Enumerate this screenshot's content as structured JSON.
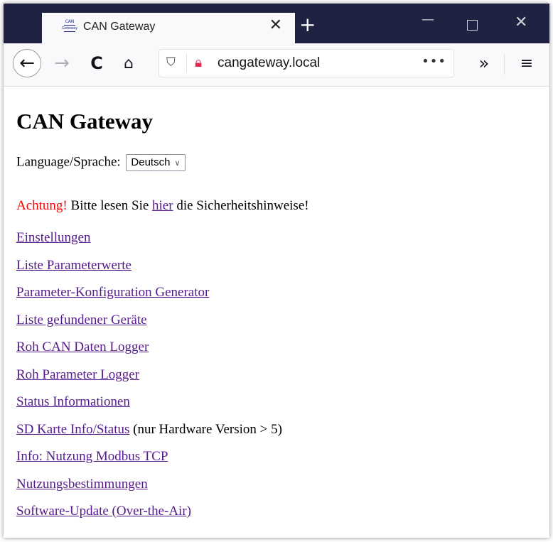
{
  "browser": {
    "tab": {
      "favicon_text_top": "CAN",
      "favicon_text_bottom": "Gateway",
      "title": "CAN Gateway",
      "close_glyph": "✕"
    },
    "new_tab_glyph": "+",
    "window_controls": {
      "minimize": "—",
      "close": "✕"
    },
    "nav": {
      "back_glyph": "←",
      "forward_glyph": "→",
      "reload_glyph": "C",
      "home_glyph": "⌂",
      "url": "cangateway.local",
      "page_actions_glyph": "•••",
      "overflow_glyph": "»",
      "menu_glyph": "≡"
    }
  },
  "page": {
    "title": "CAN Gateway",
    "language": {
      "label": "Language/Sprache:",
      "selected": "Deutsch"
    },
    "warning": {
      "prefix": "Achtung!",
      "text_before": " Bitte lesen Sie ",
      "link": "hier",
      "text_after": " die Sicherheitshinweise!"
    },
    "links": [
      {
        "label": "Einstellungen",
        "suffix": ""
      },
      {
        "label": "Liste Parameterwerte",
        "suffix": ""
      },
      {
        "label": "Parameter-Konfiguration Generator",
        "suffix": ""
      },
      {
        "label": "Liste gefundener Geräte",
        "suffix": ""
      },
      {
        "label": "Roh CAN Daten Logger",
        "suffix": ""
      },
      {
        "label": "Roh Parameter Logger",
        "suffix": ""
      },
      {
        "label": "Status Informationen",
        "suffix": ""
      },
      {
        "label": "SD Karte Info/Status",
        "suffix": " (nur Hardware Version > 5)"
      },
      {
        "label": "Info: Nutzung Modbus TCP",
        "suffix": ""
      },
      {
        "label": "Nutzungsbestimmungen",
        "suffix": ""
      },
      {
        "label": "Software-Update (Over-the-Air)",
        "suffix": ""
      }
    ]
  },
  "colors": {
    "tabstrip": "#1f2240",
    "link": "#551a8b",
    "warning": "#ff0000",
    "insecure_lock": "#e22850"
  }
}
